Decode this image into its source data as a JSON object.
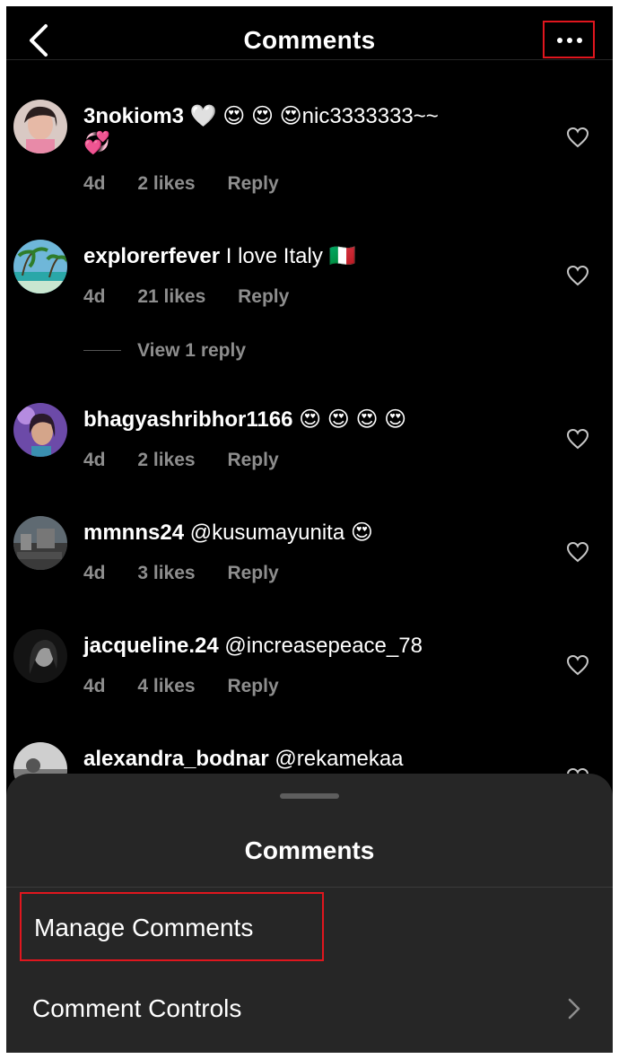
{
  "header": {
    "title": "Comments",
    "back_icon": "chevron-left-icon",
    "more_icon": "more-horizontal-icon"
  },
  "comments": [
    {
      "username": "3nokiom3",
      "text": "🤍 😍 😍 😍nic3333333~~",
      "text2": "💞",
      "time": "4d",
      "likes": "2 likes",
      "reply": "Reply"
    },
    {
      "username": "explorerfever",
      "text": "I love Italy 🇮🇹",
      "time": "4d",
      "likes": "21 likes",
      "reply": "Reply",
      "view_replies": "View 1 reply"
    },
    {
      "username": "bhagyashribhor1166",
      "text": "😍 😍 😍 😍",
      "time": "4d",
      "likes": "2 likes",
      "reply": "Reply"
    },
    {
      "username": "mmnns24",
      "text": "@kusumayunita 😍",
      "time": "4d",
      "likes": "3 likes",
      "reply": "Reply"
    },
    {
      "username": "jacqueline.24",
      "text": "@increasepeace_78",
      "time": "4d",
      "likes": "4 likes",
      "reply": "Reply"
    },
    {
      "username": "alexandra_bodnar",
      "text": "@rekamekaa"
    }
  ],
  "sheet": {
    "title": "Comments",
    "manage_label": "Manage Comments",
    "controls_label": "Comment Controls"
  },
  "colors": {
    "background": "#000000",
    "sheet": "#262626",
    "muted": "#8e8e8e",
    "highlight": "#e0161e"
  }
}
